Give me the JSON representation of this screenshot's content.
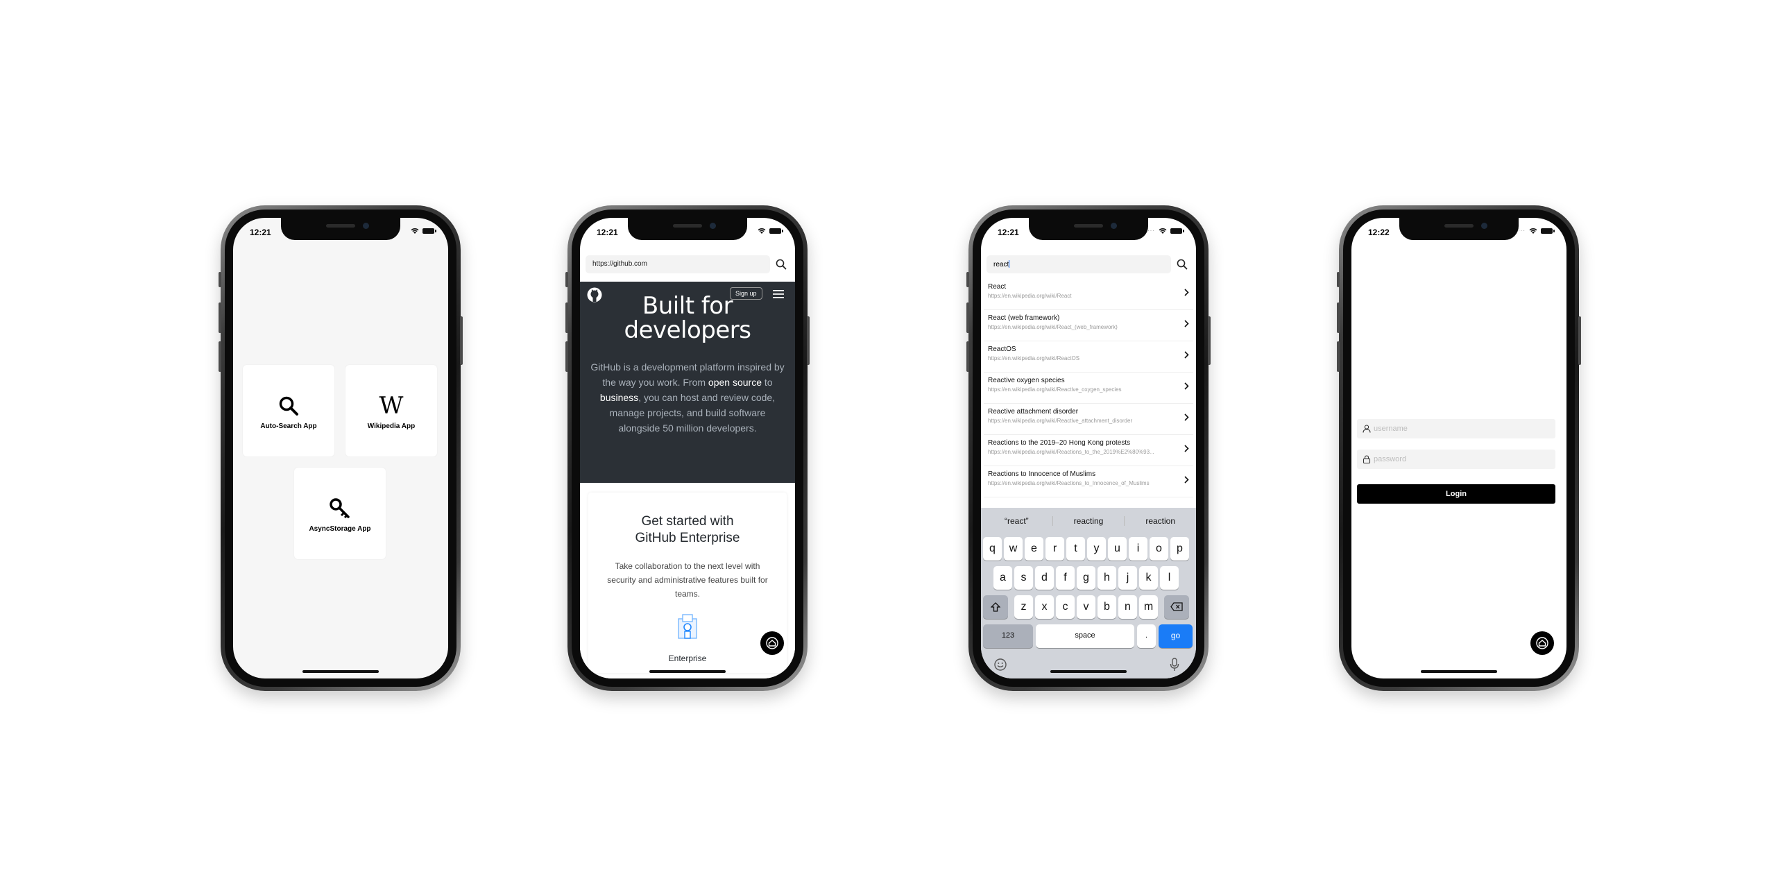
{
  "phones": [
    {
      "time": "12:21",
      "apps": [
        {
          "label": "Auto-Search App",
          "icon": "search-icon"
        },
        {
          "label": "Wikipedia App",
          "icon": "wikipedia-w-icon",
          "glyph": "W"
        },
        {
          "label": "AsyncStorage App",
          "icon": "key-icon"
        }
      ]
    },
    {
      "time": "12:21",
      "url": "https://github.com",
      "signup_label": "Sign up",
      "hero_title_line1": "Built for",
      "hero_title_line2": "developers",
      "hero_text": {
        "part1": "GitHub is a development platform inspired by the way you work. From ",
        "link1": "open source",
        "part2": " to ",
        "link2": "business",
        "part3": ", you can host and review code, manage projects, and build software alongside 50 million developers."
      },
      "card_title_line1": "Get started with",
      "card_title_line2": "GitHub Enterprise",
      "card_text": "Take collaboration to the next level with security and administrative features built for teams.",
      "enterprise_label": "Enterprise"
    },
    {
      "time": "12:21",
      "search_value": "react",
      "results": [
        {
          "title": "React",
          "url": "https://en.wikipedia.org/wiki/React"
        },
        {
          "title": "React (web framework)",
          "url": "https://en.wikipedia.org/wiki/React_(web_framework)"
        },
        {
          "title": "ReactOS",
          "url": "https://en.wikipedia.org/wiki/ReactOS"
        },
        {
          "title": "Reactive oxygen species",
          "url": "https://en.wikipedia.org/wiki/Reactive_oxygen_species"
        },
        {
          "title": "Reactive attachment disorder",
          "url": "https://en.wikipedia.org/wiki/Reactive_attachment_disorder"
        },
        {
          "title": "Reactions to the 2019–20 Hong Kong protests",
          "url": "https://en.wikipedia.org/wiki/Reactions_to_the_2019%E2%80%93..."
        },
        {
          "title": "Reactions to Innocence of Muslims",
          "url": "https://en.wikipedia.org/wiki/Reactions_to_Innocence_of_Muslims"
        }
      ],
      "suggestions": [
        "“react”",
        "reacting",
        "reaction"
      ],
      "keyboard": {
        "row1": [
          "q",
          "w",
          "e",
          "r",
          "t",
          "y",
          "u",
          "i",
          "o",
          "p"
        ],
        "row2": [
          "a",
          "s",
          "d",
          "f",
          "g",
          "h",
          "j",
          "k",
          "l"
        ],
        "row3": [
          "z",
          "x",
          "c",
          "v",
          "b",
          "n",
          "m"
        ],
        "numbers_label": "123",
        "space_label": "space",
        "period_label": ".",
        "go_label": "go"
      }
    },
    {
      "time": "12:22",
      "username_placeholder": "username",
      "password_placeholder": "password",
      "login_label": "Login"
    }
  ],
  "colors": {
    "github_dark": "#2b3036",
    "keyboard_bg": "#d1d4da",
    "go_key": "#1a7cf7",
    "accent_caret": "#1a6ef5"
  }
}
